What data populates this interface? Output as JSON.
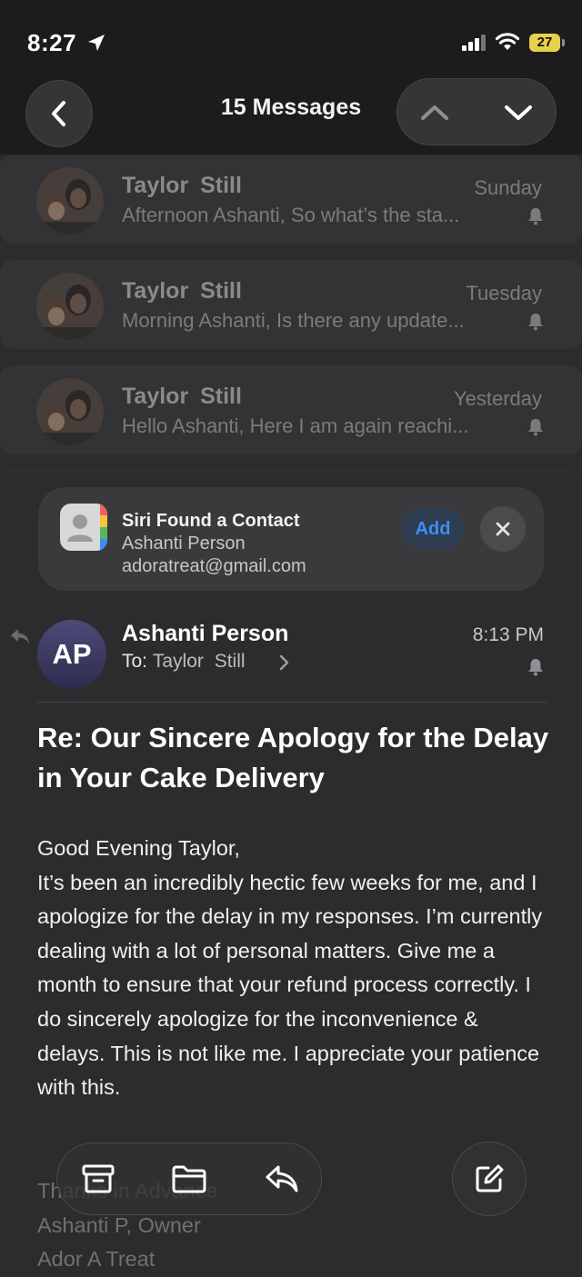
{
  "status_bar": {
    "time": "8:27",
    "battery": "27"
  },
  "nav": {
    "title": "15 Messages"
  },
  "messages": [
    {
      "sender": "Taylor  Still",
      "date": "Sunday",
      "preview": "Afternoon Ashanti, So what’s the sta..."
    },
    {
      "sender": "Taylor  Still",
      "date": "Tuesday",
      "preview": "Morning Ashanti, Is there any update..."
    },
    {
      "sender": "Taylor  Still",
      "date": "Yesterday",
      "preview": "Hello Ashanti, Here I am again reachi..."
    }
  ],
  "siri_banner": {
    "title": "Siri Found a Contact",
    "name": "Ashanti Person",
    "email": "adoratreat@gmail.com",
    "add_label": "Add"
  },
  "email": {
    "avatar_initials": "AP",
    "sender": "Ashanti Person",
    "to_label": "To:",
    "to_name": "Taylor  Still",
    "time": "8:13 PM",
    "subject": "Re: Our Sincere Apology for the Delay in Your Cake Delivery",
    "greeting": "Good Evening Taylor,",
    "body": "It’s been an incredibly hectic few weeks for me, and I apologize for the delay in my responses. I’m currently dealing with a lot of personal matters. Give me a month to ensure that your refund process correctly. I do sincerely apologize for the inconvenience & delays. This is not like me. I appreciate your patience with this.",
    "signoff_1": "Thanks in Advance",
    "signoff_2": "Ashanti P, Owner",
    "signoff_3": "Ador A Treat"
  },
  "colors": {
    "accent": "#3d8ef7",
    "background": "#2c2c2e",
    "battery": "#e6d24a"
  },
  "icons": {
    "back": "chevron-left-icon",
    "up": "chevron-up-icon",
    "down": "chevron-down-icon",
    "archive": "archive-icon",
    "folder": "folder-icon",
    "reply": "reply-icon",
    "compose": "compose-icon"
  }
}
